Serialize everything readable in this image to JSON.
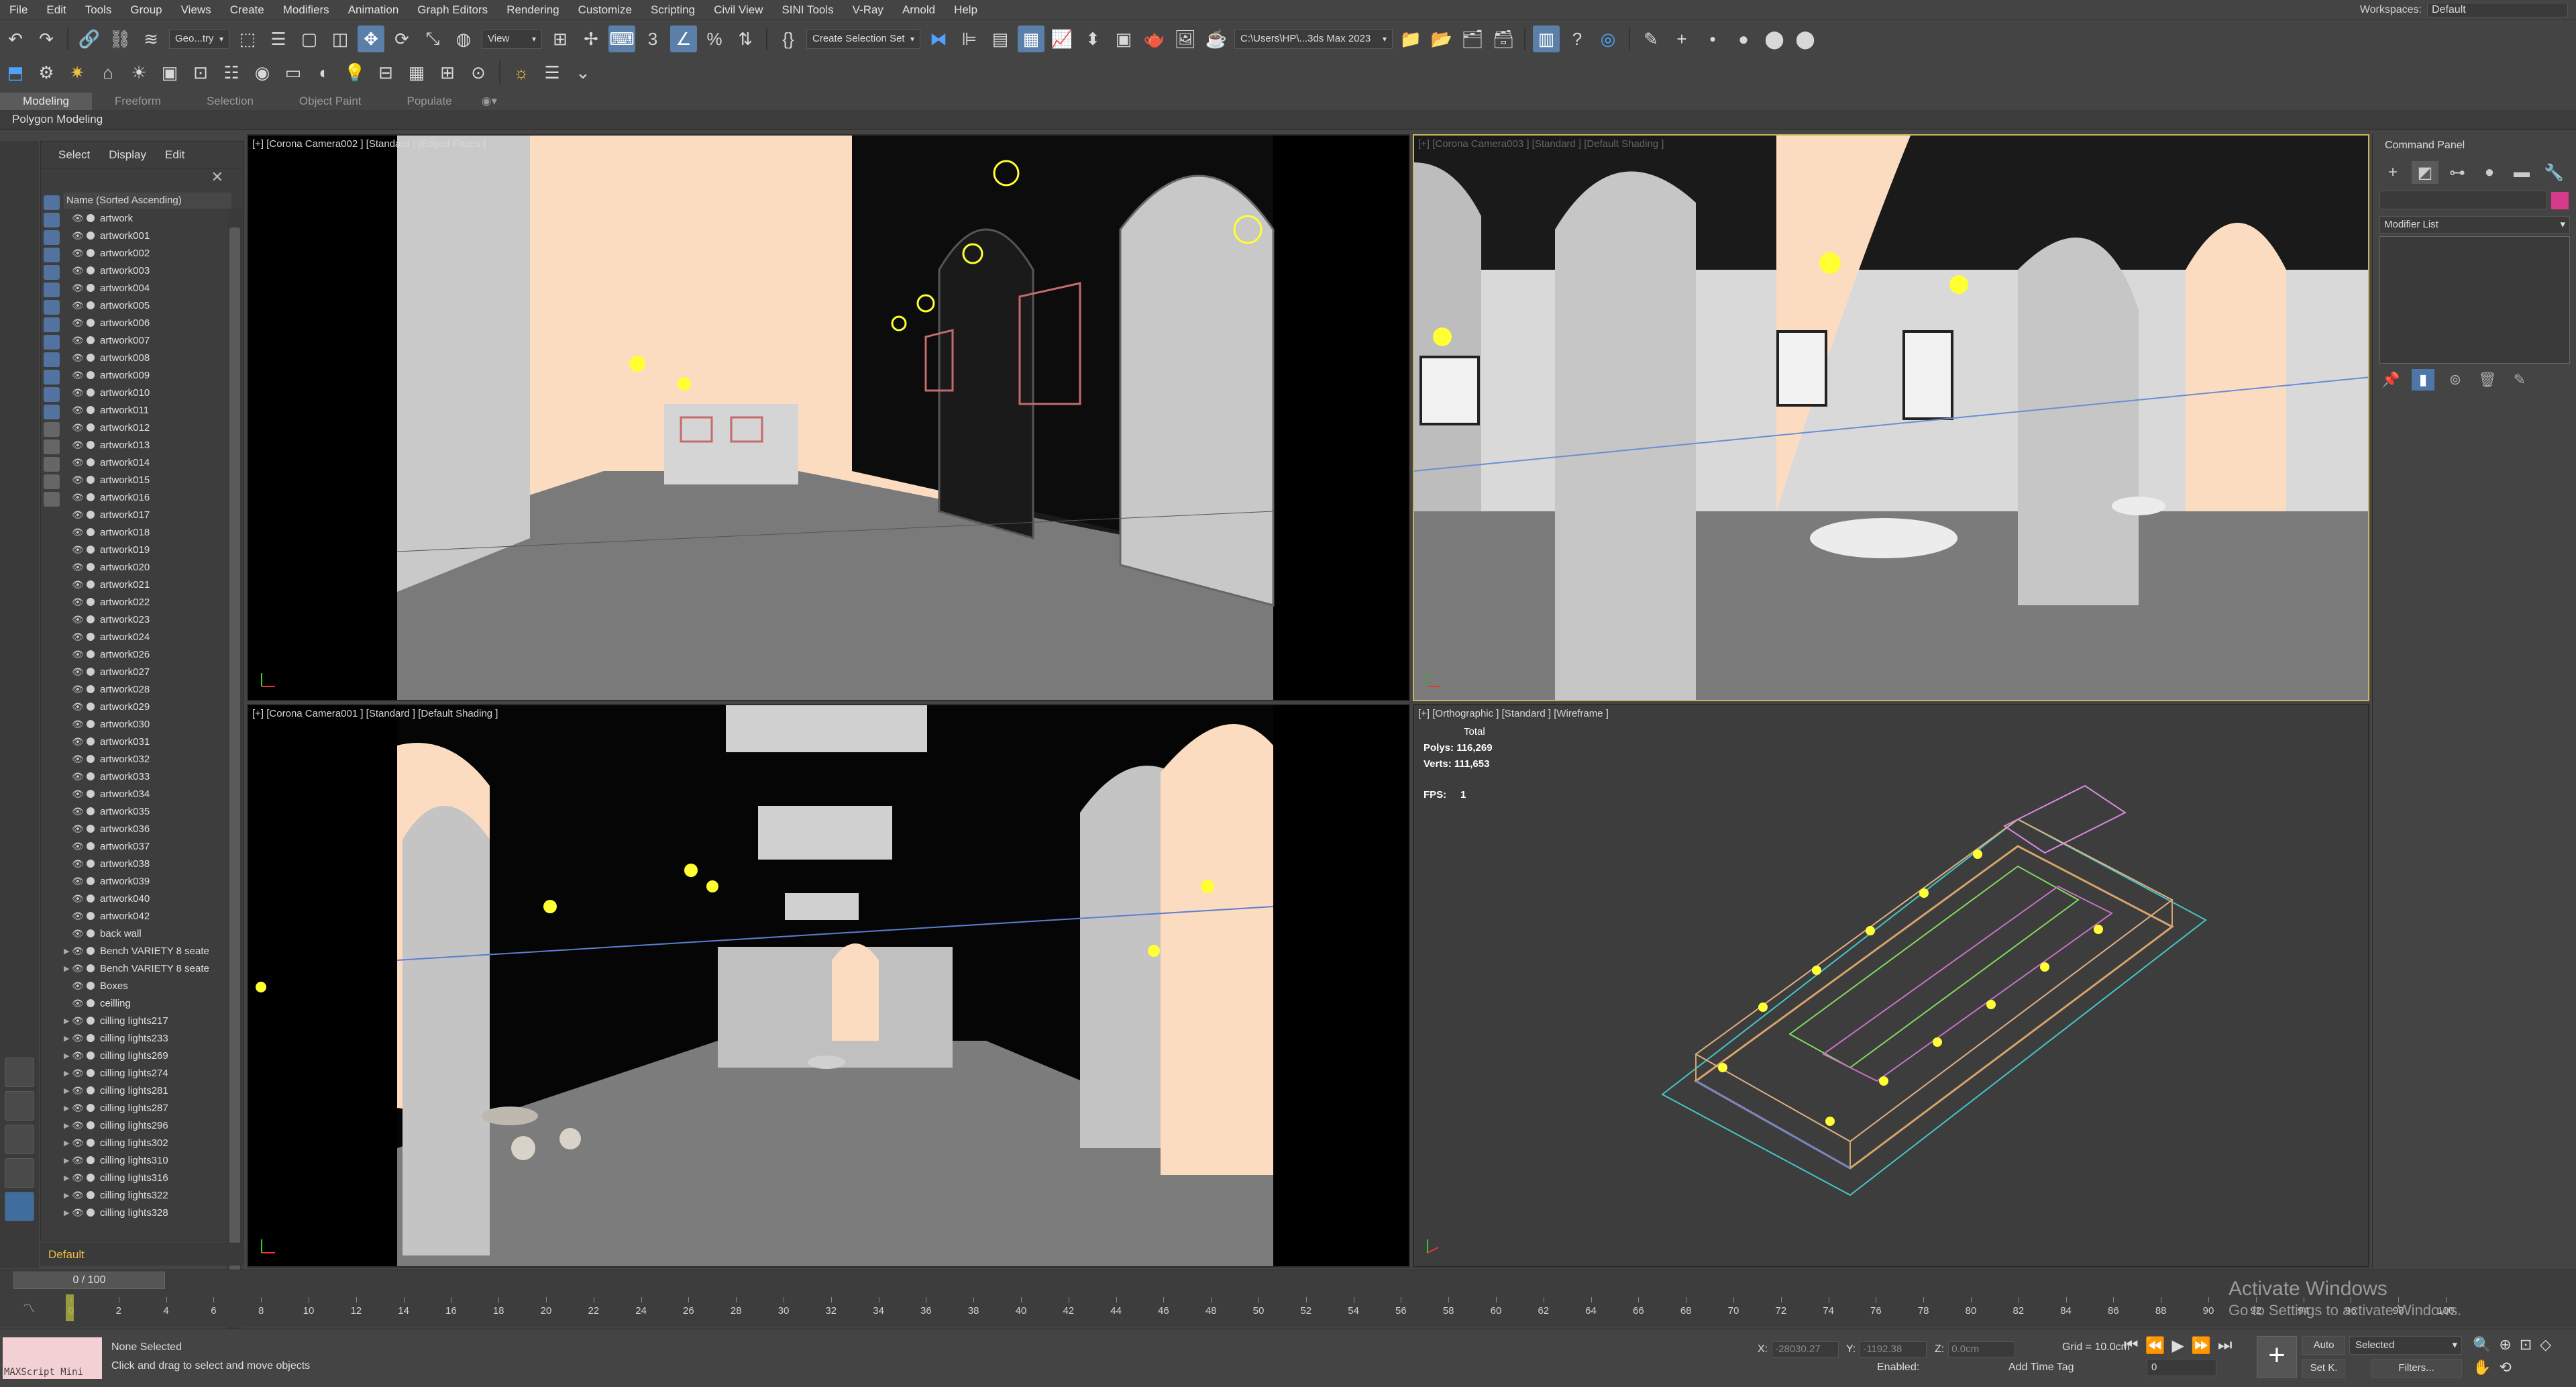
{
  "menu": [
    "File",
    "Edit",
    "Tools",
    "Group",
    "Views",
    "Create",
    "Modifiers",
    "Animation",
    "Graph Editors",
    "Rendering",
    "Customize",
    "Scripting",
    "Civil View",
    "SINI Tools",
    "V-Ray",
    "Arnold",
    "Help"
  ],
  "workspace": {
    "label": "Workspaces:",
    "value": "Default"
  },
  "toolbar": {
    "selection_filter": "Geo...try",
    "ref_coord": "View",
    "named_selection": "Create Selection Set",
    "project_path": "C:\\Users\\HP\\...3ds Max 2023"
  },
  "ribbon": {
    "tabs": [
      "Modeling",
      "Freeform",
      "Selection",
      "Object Paint",
      "Populate"
    ],
    "active_tab": "Modeling",
    "sub_label": "Polygon Modeling"
  },
  "scene_explorer": {
    "tabs": [
      "Select",
      "Display",
      "Edit"
    ],
    "column_header": "Name (Sorted Ascending)",
    "items": [
      {
        "name": "artwork",
        "expand": false
      },
      {
        "name": "artwork001",
        "expand": false
      },
      {
        "name": "artwork002",
        "expand": false
      },
      {
        "name": "artwork003",
        "expand": false
      },
      {
        "name": "artwork004",
        "expand": false
      },
      {
        "name": "artwork005",
        "expand": false
      },
      {
        "name": "artwork006",
        "expand": false
      },
      {
        "name": "artwork007",
        "expand": false
      },
      {
        "name": "artwork008",
        "expand": false
      },
      {
        "name": "artwork009",
        "expand": false
      },
      {
        "name": "artwork010",
        "expand": false
      },
      {
        "name": "artwork011",
        "expand": false
      },
      {
        "name": "artwork012",
        "expand": false
      },
      {
        "name": "artwork013",
        "expand": false
      },
      {
        "name": "artwork014",
        "expand": false
      },
      {
        "name": "artwork015",
        "expand": false
      },
      {
        "name": "artwork016",
        "expand": false
      },
      {
        "name": "artwork017",
        "expand": false
      },
      {
        "name": "artwork018",
        "expand": false
      },
      {
        "name": "artwork019",
        "expand": false
      },
      {
        "name": "artwork020",
        "expand": false
      },
      {
        "name": "artwork021",
        "expand": false
      },
      {
        "name": "artwork022",
        "expand": false
      },
      {
        "name": "artwork023",
        "expand": false
      },
      {
        "name": "artwork024",
        "expand": false
      },
      {
        "name": "artwork026",
        "expand": false
      },
      {
        "name": "artwork027",
        "expand": false
      },
      {
        "name": "artwork028",
        "expand": false
      },
      {
        "name": "artwork029",
        "expand": false
      },
      {
        "name": "artwork030",
        "expand": false
      },
      {
        "name": "artwork031",
        "expand": false
      },
      {
        "name": "artwork032",
        "expand": false
      },
      {
        "name": "artwork033",
        "expand": false
      },
      {
        "name": "artwork034",
        "expand": false
      },
      {
        "name": "artwork035",
        "expand": false
      },
      {
        "name": "artwork036",
        "expand": false
      },
      {
        "name": "artwork037",
        "expand": false
      },
      {
        "name": "artwork038",
        "expand": false
      },
      {
        "name": "artwork039",
        "expand": false
      },
      {
        "name": "artwork040",
        "expand": false
      },
      {
        "name": "artwork042",
        "expand": false
      },
      {
        "name": "back wall",
        "expand": false
      },
      {
        "name": "Bench VARIETY 8 seate",
        "expand": true
      },
      {
        "name": "Bench VARIETY 8 seate",
        "expand": true
      },
      {
        "name": "Boxes",
        "expand": false
      },
      {
        "name": "ceilling",
        "expand": false
      },
      {
        "name": "cilling lights217",
        "expand": true
      },
      {
        "name": "cilling lights233",
        "expand": true
      },
      {
        "name": "cilling lights269",
        "expand": true
      },
      {
        "name": "cilling lights274",
        "expand": true
      },
      {
        "name": "cilling lights281",
        "expand": true
      },
      {
        "name": "cilling lights287",
        "expand": true
      },
      {
        "name": "cilling lights296",
        "expand": true
      },
      {
        "name": "cilling lights302",
        "expand": true
      },
      {
        "name": "cilling lights310",
        "expand": true
      },
      {
        "name": "cilling lights316",
        "expand": true
      },
      {
        "name": "cilling lights322",
        "expand": true
      },
      {
        "name": "cilling lights328",
        "expand": true
      }
    ]
  },
  "layer": "Default",
  "viewports": {
    "top_left": {
      "label": "[+] [Corona Camera002 ] [Standard ] [Edged Faces ]"
    },
    "top_right": {
      "label": "[+] [Corona Camera003 ] [Standard ] [Default Shading ]"
    },
    "bottom_left": {
      "label": "[+] [Corona Camera001 ] [Standard ] [Default Shading ]"
    },
    "bottom_right": {
      "label": "[+] [Orthographic ] [Standard ] [Wireframe ]",
      "stats": {
        "total_label": "Total",
        "polys_label": "Polys:",
        "polys": "116,269",
        "verts_label": "Verts:",
        "verts": "111,653",
        "fps_label": "FPS:",
        "fps": "1"
      }
    }
  },
  "command_panel": {
    "title": "Command Panel",
    "modifier_list": "Modifier List"
  },
  "timeline": {
    "frame_display": "0 / 100",
    "ticks": [
      0,
      2,
      4,
      6,
      8,
      10,
      12,
      14,
      16,
      18,
      20,
      22,
      24,
      26,
      28,
      30,
      32,
      34,
      36,
      38,
      40,
      42,
      44,
      46,
      48,
      50,
      52,
      54,
      56,
      58,
      60,
      62,
      64,
      66,
      68,
      70,
      72,
      74,
      76,
      78,
      80,
      82,
      84,
      86,
      88,
      90,
      92,
      94,
      96,
      98,
      100
    ]
  },
  "status": {
    "maxscript_label": "MAXScript Mini",
    "line1": "None Selected",
    "line2": "Click and drag to select and move objects",
    "x_label": "X:",
    "x_value": "-28030.27",
    "y_label": "Y:",
    "y_value": "-1192.38",
    "z_label": "Z:",
    "z_value": "0.0cm",
    "grid": "Grid = 10.0cm",
    "enabled": "Enabled:",
    "add_time_tag": "Add Time Tag",
    "frame_value": "0",
    "auto": "Auto",
    "set_key": "Set K.",
    "selected": "Selected",
    "filters": "Filters..."
  },
  "activation": {
    "title": "Activate Windows",
    "subtitle": "Go to Settings to activate Windows."
  }
}
